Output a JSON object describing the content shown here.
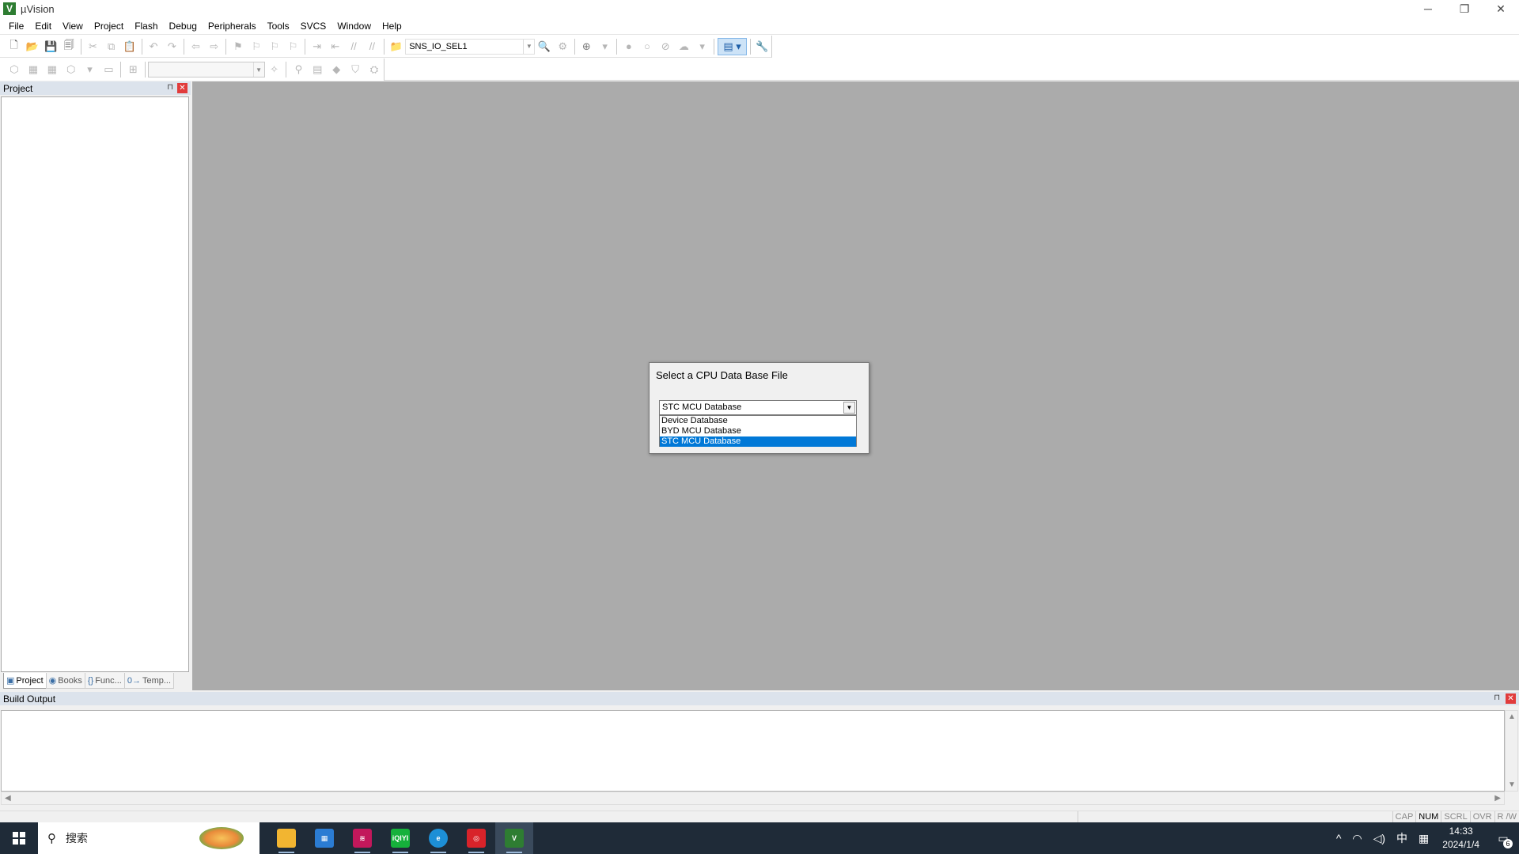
{
  "window": {
    "title": "µVision",
    "minimize": "─",
    "maximize": "❐",
    "close": "✕"
  },
  "menu": [
    "File",
    "Edit",
    "View",
    "Project",
    "Flash",
    "Debug",
    "Peripherals",
    "Tools",
    "SVCS",
    "Window",
    "Help"
  ],
  "toolbar": {
    "target_name": "SNS_IO_SEL1",
    "find_value": ""
  },
  "project_panel": {
    "title": "Project",
    "pin": "⊓",
    "close": "✕",
    "tabs": [
      {
        "icon": "▣",
        "label": "Project"
      },
      {
        "icon": "◉",
        "label": "Books"
      },
      {
        "icon": "{}",
        "label": "Func..."
      },
      {
        "icon": "0→",
        "label": "Temp..."
      }
    ]
  },
  "build_output": {
    "title": "Build Output",
    "text": ""
  },
  "dialog": {
    "title": "Select a CPU Data Base File",
    "selected": "STC MCU Database",
    "options": [
      "Device Database",
      "BYD MCU Database",
      "STC MCU Database"
    ]
  },
  "statusbar": {
    "cells": [
      "CAP",
      "NUM",
      "SCRL",
      "OVR",
      "R /W"
    ],
    "active": [
      "NUM"
    ]
  },
  "taskbar": {
    "search_placeholder": "搜索",
    "apps": [
      {
        "name": "file-explorer",
        "label": "",
        "color": "#f2b531"
      },
      {
        "name": "store",
        "label": "",
        "color": "#2b7cd3"
      },
      {
        "name": "app-red-stripes",
        "label": "",
        "color": "#c2185b"
      },
      {
        "name": "iqiyi",
        "label": "iQIYI",
        "color": "#16b13b"
      },
      {
        "name": "edge",
        "label": "",
        "color": "#1d8fd6"
      },
      {
        "name": "app-red-circle",
        "label": "",
        "color": "#d8232a"
      },
      {
        "name": "keil-uvision",
        "label": "V",
        "color": "#2e7d32"
      }
    ],
    "tray": {
      "chevron": "^",
      "network": "◠",
      "volume": "◁)",
      "ime": "中",
      "keyboard": "▦",
      "time": "14:33",
      "date": "2024/1/4",
      "notifications": "6"
    }
  }
}
